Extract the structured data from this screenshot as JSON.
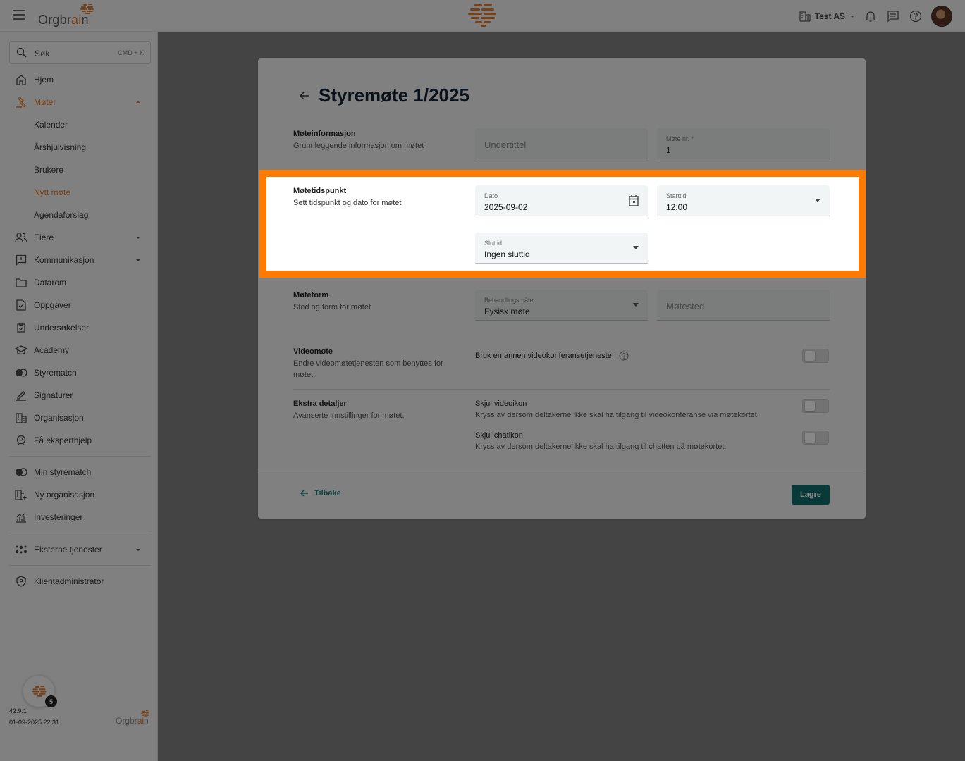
{
  "topbar": {
    "logo_prefix": "Orgbr",
    "logo_highlight": "ai",
    "logo_suffix": "n",
    "org_name": "Test AS"
  },
  "sidebar": {
    "search_label": "Søk",
    "search_shortcut": "CMD + K",
    "items": [
      {
        "label": "Hjem",
        "icon": "home-icon"
      },
      {
        "label": "Møter",
        "icon": "gavel-icon"
      },
      {
        "label": "Kalender"
      },
      {
        "label": "Årshjulvisning"
      },
      {
        "label": "Brukere"
      },
      {
        "label": "Nytt møte"
      },
      {
        "label": "Agendaforslag"
      },
      {
        "label": "Eiere",
        "icon": "people-icon"
      },
      {
        "label": "Kommunikasjon",
        "icon": "message-icon"
      },
      {
        "label": "Datarom",
        "icon": "folder-icon"
      },
      {
        "label": "Oppgaver",
        "icon": "task-icon"
      },
      {
        "label": "Undersøkelser",
        "icon": "survey-icon"
      },
      {
        "label": "Academy",
        "icon": "academy-icon"
      },
      {
        "label": "Styrematch",
        "icon": "match-icon"
      },
      {
        "label": "Signaturer",
        "icon": "pen-icon"
      },
      {
        "label": "Organisasjon",
        "icon": "building-icon"
      },
      {
        "label": "Få eksperthjelp",
        "icon": "expert-icon"
      },
      {
        "label": "Min styrematch",
        "icon": "match-icon"
      },
      {
        "label": "Ny organisasjon",
        "icon": "building-add-icon"
      },
      {
        "label": "Investeringer",
        "icon": "chart-icon"
      },
      {
        "label": "Eksterne tjenester",
        "icon": "services-icon"
      },
      {
        "label": "Klientadministrator",
        "icon": "shield-icon"
      }
    ],
    "badge_count": "5",
    "version": "42.9.1",
    "build_time": "01-09-2025 22:31",
    "footer_logo_prefix": "Orgbr",
    "footer_logo_highlight": "ai",
    "footer_logo_suffix": "n"
  },
  "page": {
    "title": "Styremøte 1/2025",
    "sections": {
      "info": {
        "title": "Møteinformasjon",
        "desc": "Grunnleggende informasjon om møtet",
        "subtitle_placeholder": "Undertittel",
        "meeting_no_label": "Møte nr. *",
        "meeting_no_value": "1"
      },
      "time": {
        "title": "Møtetidspunkt",
        "desc": "Sett tidspunkt og dato for møtet",
        "date_label": "Dato",
        "date_value": "2025-09-02",
        "start_label": "Starttid",
        "start_value": "12:00",
        "end_label": "Sluttid",
        "end_value": "Ingen sluttid"
      },
      "form": {
        "title": "Møteform",
        "desc": "Sted og form for møtet",
        "mode_label": "Behandlingsmåte",
        "mode_value": "Fysisk møte",
        "place_placeholder": "Møtested"
      },
      "video": {
        "title": "Videomøte",
        "desc": "Endre videomøtetjenesten som benyttes for møtet.",
        "option": "Bruk en annen videokonferansetjeneste"
      },
      "extra": {
        "title": "Ekstra detaljer",
        "desc": "Avanserte innstillinger for møtet.",
        "opt1_title": "Skjul videoikon",
        "opt1_desc": "Kryss av dersom deltakerne ikke skal ha tilgang til videokonferanse via møtekortet.",
        "opt2_title": "Skjul chatikon",
        "opt2_desc": "Kryss av dersom deltakerne ikke skal ha tilgang til chatten på møtekortet."
      }
    },
    "back_label": "Tilbake",
    "save_label": "Lagre"
  },
  "colors": {
    "accent": "#e07a2a",
    "highlight": "#ff7a00",
    "primary": "#0f6e6a"
  }
}
